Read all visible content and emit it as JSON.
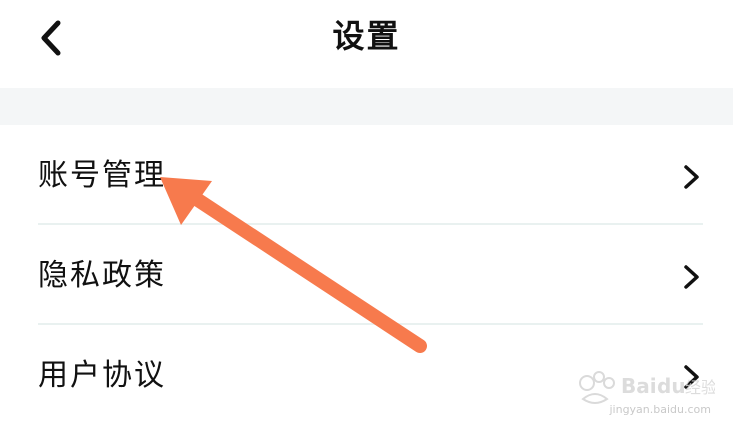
{
  "header": {
    "back_icon": "chevron-left-icon",
    "title": "设置"
  },
  "settings": {
    "items": [
      {
        "label": "账号管理",
        "icon": "chevron-right-icon"
      },
      {
        "label": "隐私政策",
        "icon": "chevron-right-icon"
      },
      {
        "label": "用户协议",
        "icon": "chevron-right-icon"
      }
    ]
  },
  "annotation": {
    "color": "#f77a4d",
    "points_to": "账号管理"
  },
  "watermark": {
    "text": "jingyan.baidu.com"
  }
}
